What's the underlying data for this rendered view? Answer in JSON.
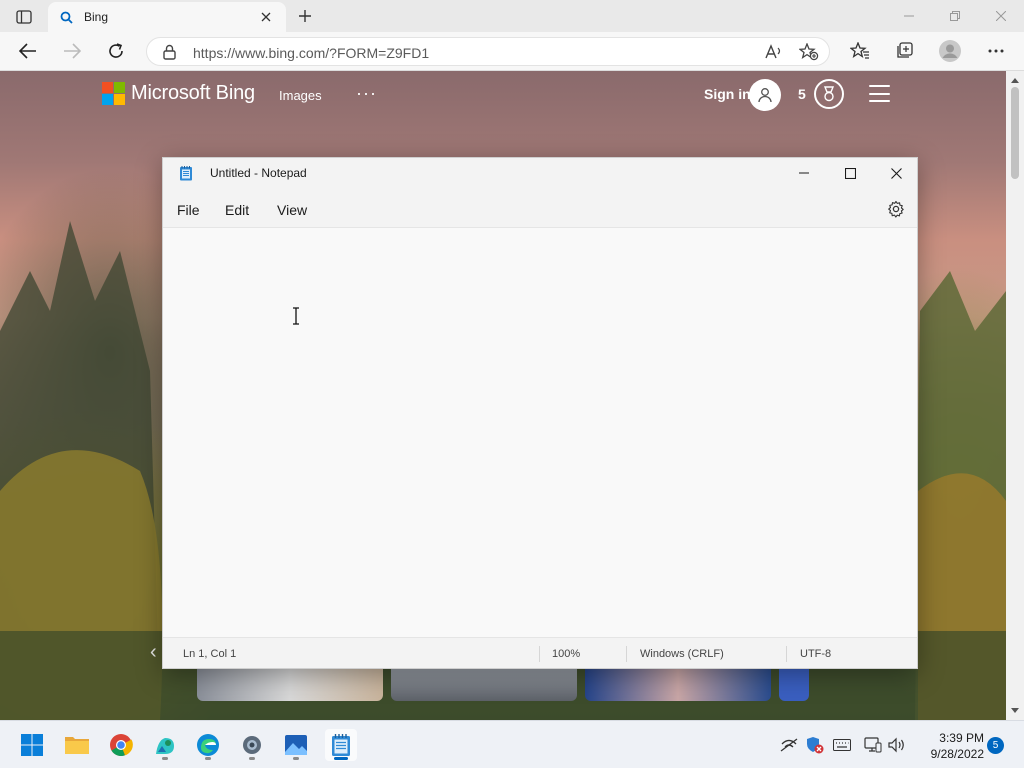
{
  "browser": {
    "tab_title": "Bing",
    "url": "https://www.bing.com/?FORM=Z9FD1",
    "colors": {
      "tabbar": "#e9e9e9",
      "toolbar": "#f7f7f7"
    }
  },
  "bing": {
    "brand": "Microsoft Bing",
    "nav_images": "Images",
    "more": "···",
    "sign_in": "Sign in",
    "rewards_count": "5",
    "logo_colors": [
      "#f25022",
      "#7fba00",
      "#00a4ef",
      "#ffb900"
    ]
  },
  "notepad": {
    "title": "Untitled - Notepad",
    "menu": {
      "file": "File",
      "edit": "Edit",
      "view": "View"
    },
    "content": "",
    "status": {
      "position": "Ln 1, Col 1",
      "zoom": "100%",
      "line_ending": "Windows (CRLF)",
      "encoding": "UTF-8"
    }
  },
  "taskbar": {
    "apps": [
      "start-icon",
      "file-explorer-icon",
      "chrome-icon",
      "store-icon",
      "edge-icon",
      "settings-icon",
      "photos-icon",
      "notepad-icon"
    ],
    "time": "3:39 PM",
    "date": "9/28/2022",
    "notification_count": "5",
    "accent": "#0067c0"
  }
}
